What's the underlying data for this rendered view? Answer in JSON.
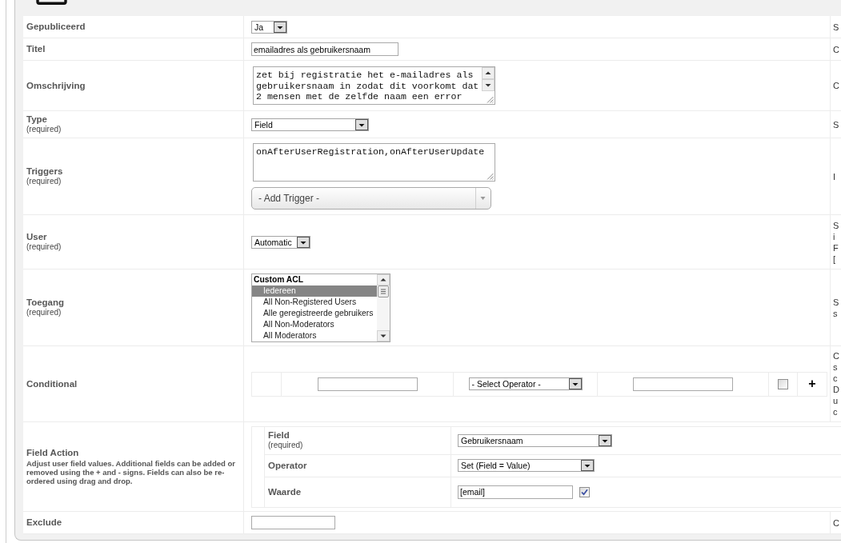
{
  "rows": [
    {
      "kind": "select",
      "label": "Gepubliceerd",
      "value": "Ja",
      "column_3": [
        "S"
      ]
    },
    {
      "kind": "input",
      "label": "Titel",
      "value": "emailadres als gebruikersnaam",
      "column_3": [
        "C"
      ]
    },
    {
      "kind": "textarea",
      "label": "Omschrijving",
      "value": "zet bij registratie het e-mailadres als gebruikersnaam in zodat dit voorkomt dat 2 mensen met de zelfde naam een error",
      "column_3": [
        "C"
      ]
    },
    {
      "kind": "select",
      "label": "Type",
      "note": "(required)",
      "value": "Field",
      "column_3": [
        "S"
      ]
    },
    {
      "kind": "triggers",
      "label": "Triggers",
      "note": "(required)",
      "value": "onAfterUserRegistration,onAfterUserUpdate",
      "add_trigger": "- Add Trigger -",
      "column_3": [
        "I"
      ]
    },
    {
      "kind": "select",
      "label": "User",
      "note": "(required)",
      "value": "Automatic",
      "column_3": [
        "S",
        "i",
        "F",
        "["
      ]
    },
    {
      "kind": "listbox",
      "label": "Toegang",
      "note": "(required)",
      "group": "Custom ACL",
      "options": [
        {
          "label": "Iedereen",
          "selected": true
        },
        {
          "label": "All Non-Registered Users",
          "selected": false
        },
        {
          "label": "Alle geregistreerde gebruikers",
          "selected": false
        },
        {
          "label": "All Non-Moderators",
          "selected": false
        },
        {
          "label": "All Moderators",
          "selected": false
        }
      ],
      "column_3": [
        "S",
        "s"
      ]
    },
    {
      "kind": "conditional",
      "label": "Conditional",
      "controls": [
        {
          "kind": "input"
        },
        {
          "kind": "select",
          "value": "- Select Operator -"
        },
        {
          "kind": "input"
        },
        {
          "kind": "checkbox",
          "checked": false
        },
        {
          "kind": "button",
          "label": "+"
        }
      ],
      "column_3": [
        "C",
        "s",
        "c",
        "D",
        "u",
        "c"
      ]
    },
    {
      "kind": "field_action",
      "label": "Field Action",
      "description": "Adjust user field values. Additional fields can be added or removed using the + and - signs. Fields can also be re-ordered using drag and drop.",
      "fields": [
        {
          "kind": "select",
          "label": "Field",
          "note": "(required)",
          "value": "Gebruikersnaam"
        },
        {
          "kind": "select",
          "label": "Operator",
          "value": "Set (Field = Value)"
        },
        {
          "kind": "input",
          "label": "Waarde",
          "value": "[email]",
          "checked": true
        }
      ]
    },
    {
      "kind": "input",
      "label": "Exclude",
      "column_3": [
        "C"
      ]
    }
  ]
}
